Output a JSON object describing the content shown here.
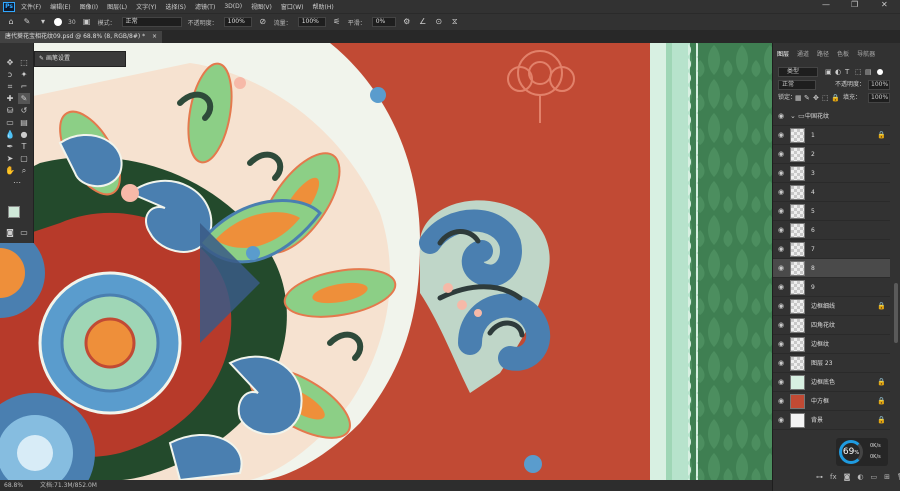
{
  "menubar": {
    "items": [
      "文件(F)",
      "编辑(E)",
      "图像(I)",
      "图层(L)",
      "文字(Y)",
      "选择(S)",
      "滤镜(T)",
      "3D(D)",
      "视图(V)",
      "窗口(W)",
      "帮助(H)"
    ],
    "win_controls": [
      "—",
      "❐",
      "✕"
    ]
  },
  "options": {
    "brush_size": "30",
    "mode_label": "模式：",
    "mode_value": "正常",
    "opacity_label": "不透明度：",
    "opacity_value": "100%",
    "flow_label": "流量：",
    "flow_value": "100%",
    "smooth_label": "平滑：",
    "smooth_value": "0%"
  },
  "document": {
    "tab_title": "唐代葵花宝相花纹09.psd @ 68.8% (8, RGB/8#) *",
    "zoom": "68.8%",
    "doc_size": "文档:71.3M/852.0M"
  },
  "brush_panel": {
    "label": "画笔设置"
  },
  "panels": {
    "tabs": [
      "图层",
      "通道",
      "路径",
      "色板",
      "导航器"
    ],
    "filter_label": "类型",
    "blend_mode": "正常",
    "opacity_label": "不透明度：",
    "opacity_value": "100%",
    "lock_label": "锁定：",
    "fill_label": "填充：",
    "fill_value": "100%"
  },
  "layers": [
    {
      "name": "中国花纹",
      "group": true,
      "locked": false
    },
    {
      "name": "1",
      "locked": true
    },
    {
      "name": "2",
      "locked": false
    },
    {
      "name": "3",
      "locked": false
    },
    {
      "name": "4",
      "locked": false
    },
    {
      "name": "5",
      "locked": false
    },
    {
      "name": "6",
      "locked": false
    },
    {
      "name": "7",
      "locked": false
    },
    {
      "name": "8",
      "locked": false,
      "selected": true
    },
    {
      "name": "9",
      "locked": false
    },
    {
      "name": "边框细线",
      "locked": true
    },
    {
      "name": "四角花纹",
      "locked": false
    },
    {
      "name": "边框纹",
      "locked": false
    },
    {
      "name": "图层 23",
      "locked": false
    },
    {
      "name": "边框底色",
      "locked": true
    },
    {
      "name": "中方框",
      "locked": true
    },
    {
      "name": "背景",
      "locked": true
    }
  ],
  "performance": {
    "value": "69",
    "unit": "%",
    "up_rate": "0K/s",
    "down_rate": "0K/s"
  },
  "colors": {
    "canvas_red": "#c14a34",
    "border_mint": "#b7e3cc",
    "border_green": "#3f7f52",
    "pattern_blue": "#4a7fb0",
    "pattern_orange": "#ee8f3a",
    "foreground_swatch": "#cfe8d8",
    "background_swatch": "#9fd6b6"
  }
}
